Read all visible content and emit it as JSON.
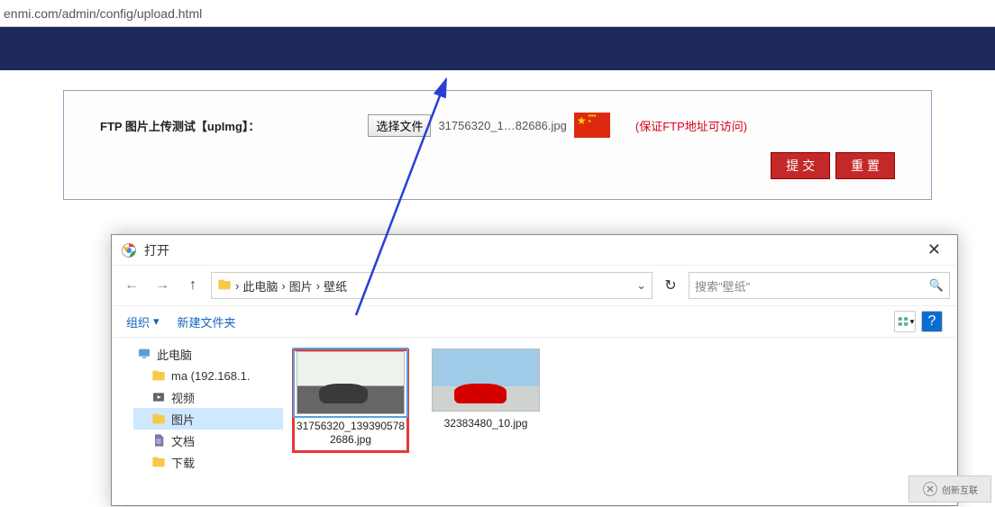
{
  "url": "enmi.com/admin/config/upload.html",
  "form": {
    "label": "FTP 图片上传测试【upImg】：",
    "choose_button": "选择文件",
    "filename": "31756320_1…82686.jpg",
    "hint": "(保证FTP地址可访问)",
    "submit": "提 交",
    "reset": "重 置"
  },
  "dialog": {
    "title": "打开",
    "nav": {
      "back": "←",
      "forward": "→",
      "up": "↑"
    },
    "breadcrumbs": [
      "此电脑",
      "图片",
      "壁纸"
    ],
    "refresh": "↻",
    "search_placeholder": "搜索\"壁纸\"",
    "toolbar": {
      "organize": "组织",
      "new_folder": "新建文件夹"
    },
    "tree": [
      {
        "label": "此电脑",
        "icon": "pc",
        "level": 0
      },
      {
        "label": "ma (192.168.1.",
        "icon": "folder",
        "level": 1
      },
      {
        "label": "视频",
        "icon": "video",
        "level": 1
      },
      {
        "label": "图片",
        "icon": "folder",
        "level": 1,
        "selected": true
      },
      {
        "label": "文档",
        "icon": "doc",
        "level": 1
      },
      {
        "label": "下载",
        "icon": "folder",
        "level": 1
      }
    ],
    "files": [
      {
        "name": "31756320_1393905782686.jpg",
        "selected": true,
        "thumb": "car1"
      },
      {
        "name": "32383480_10.jpg",
        "selected": false,
        "thumb": "car2"
      }
    ]
  },
  "watermark": "创新互联"
}
